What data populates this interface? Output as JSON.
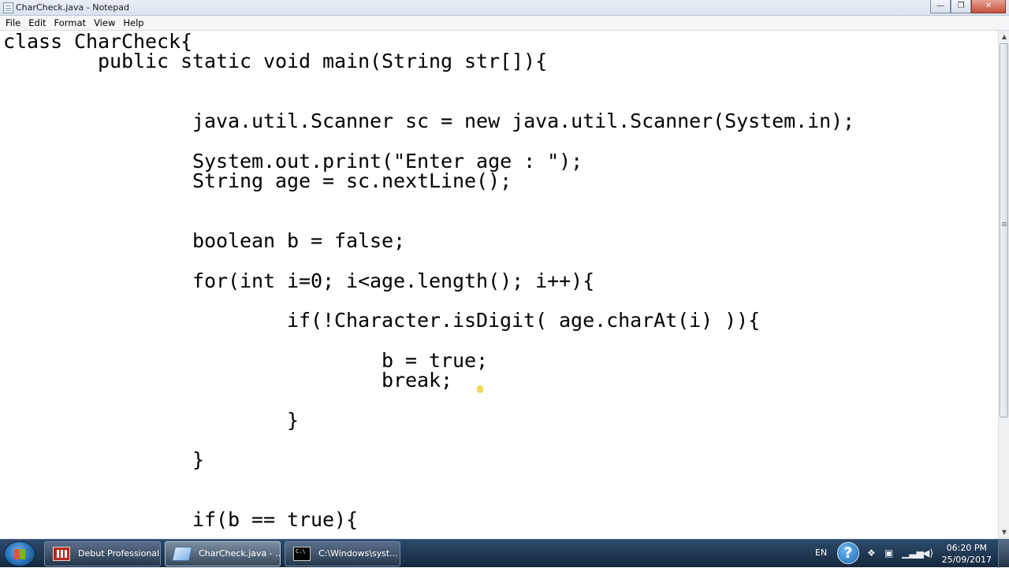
{
  "window": {
    "title": "CharCheck.java - Notepad",
    "controls": {
      "minimize": "—",
      "maximize": "❐",
      "close": "✕"
    }
  },
  "menu": {
    "file": "File",
    "edit": "Edit",
    "format": "Format",
    "view": "View",
    "help": "Help"
  },
  "editor": {
    "content": "class CharCheck{\n\tpublic static void main(String str[]){\n\n\n\t\tjava.util.Scanner sc = new java.util.Scanner(System.in);\n\n\t\tSystem.out.print(\"Enter age : \");\n\t\tString age = sc.nextLine();\n\n\n\t\tboolean b = false;\n\n\t\tfor(int i=0; i<age.length(); i++){\n\n\t\t\tif(!Character.isDigit( age.charAt(i) )){\n\n\t\t\t\tb = true;\n\t\t\t\tbreak;\n\n\t\t\t}\n\n\t\t}\n\n\n\t\tif(b == true){"
  },
  "scrollbar": {
    "up": "▲",
    "down": "▼",
    "scroll_position": 0
  },
  "taskbar": {
    "items": [
      {
        "label": "Debut Professional",
        "icon": "debut-icon"
      },
      {
        "label": "CharCheck.java - ...",
        "icon": "notepad-icon",
        "active": true
      },
      {
        "label": "C:\\Windows\\syst...",
        "icon": "cmd-icon"
      }
    ],
    "tray": {
      "language": "EN",
      "help": "?",
      "time": "06:20 PM",
      "date": "25/09/2017"
    }
  },
  "colors": {
    "taskbar": "#1e3652",
    "editor_bg": "#ffffff",
    "text": "#000000"
  }
}
